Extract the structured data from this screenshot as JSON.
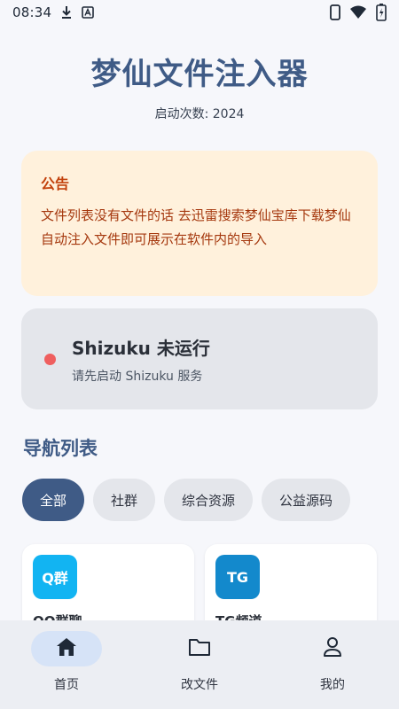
{
  "status_bar": {
    "time": "08:34",
    "icons_left": [
      "download-icon",
      "accessibility-text-icon"
    ],
    "icons_right": [
      "phone-icon",
      "wifi-icon",
      "battery-icon"
    ]
  },
  "header": {
    "title": "梦仙文件注入器",
    "launch_count_label": "启动次数: 2024"
  },
  "notice": {
    "title": "公告",
    "body": "文件列表没有文件的话 去迅雷搜索梦仙宝库下载梦仙自动注入文件即可展示在软件内的导入"
  },
  "shizuku": {
    "title": "Shizuku 未运行",
    "subtitle": "请先启动 Shizuku 服务",
    "status_color": "#ef5f5f"
  },
  "nav_list": {
    "heading": "导航列表",
    "chips": [
      {
        "label": "全部",
        "active": true
      },
      {
        "label": "社群",
        "active": false
      },
      {
        "label": "综合资源",
        "active": false
      },
      {
        "label": "公益源码",
        "active": false
      }
    ],
    "cards": [
      {
        "badge": "Q群",
        "label": "QQ群聊",
        "badge_color": "#12b4f2"
      },
      {
        "badge": "TG",
        "label": "TG频道",
        "badge_color": "#1389cc"
      }
    ]
  },
  "bottom_nav": {
    "items": [
      {
        "label": "首页",
        "icon": "home-icon",
        "active": true
      },
      {
        "label": "改文件",
        "icon": "folder-icon",
        "active": false
      },
      {
        "label": "我的",
        "icon": "person-icon",
        "active": false
      }
    ]
  },
  "colors": {
    "primary": "#3f5b86",
    "notice_bg": "#fff1dc",
    "notice_text": "#c2410c",
    "card_bg": "#e4e6eb"
  }
}
